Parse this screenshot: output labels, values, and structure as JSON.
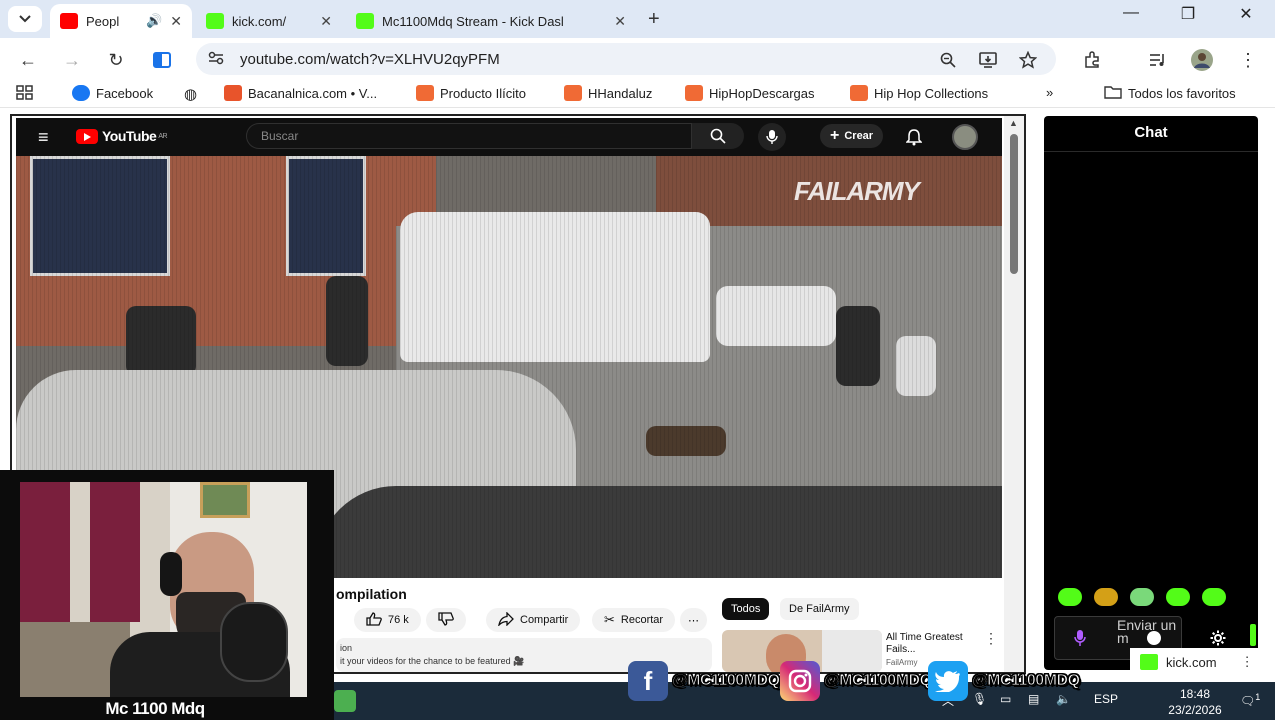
{
  "browser": {
    "tabs": [
      {
        "title": "Peopl",
        "favicon_color": "#ff0000",
        "has_audio": true
      },
      {
        "title": "kick.com/",
        "favicon_color": "#53fc18"
      },
      {
        "title": "Mc1100Mdq Stream - Kick Dasl",
        "favicon_color": "#53fc18"
      }
    ],
    "url": "youtube.com/watch?v=XLHVU2qyPFM",
    "bookmarks": [
      {
        "label": "Facebook",
        "color": "#1877f2"
      },
      {
        "label": "Bacanalnica.com • V...",
        "color": "#e8542b"
      },
      {
        "label": "Producto Ilícito",
        "color": "#f06a35"
      },
      {
        "label": "HHandaluz",
        "color": "#f06a35"
      },
      {
        "label": "HipHopDescargas",
        "color": "#f06a35"
      },
      {
        "label": "Hip Hop Collections",
        "color": "#f06a35"
      }
    ],
    "all_bookmarks_label": "Todos los favoritos"
  },
  "youtube": {
    "logo_text": "YouTube",
    "country_code": "AR",
    "search_placeholder": "Buscar",
    "create_label": "Crear",
    "watermark": "FAILARMY",
    "video_title": "ompilation",
    "likes": "76 k",
    "share_label": "Compartir",
    "clip_label": "Recortar",
    "description_line1": "ion",
    "description_line2": "it your videos for the chance to be featured 🎥",
    "chips": [
      {
        "label": "Todos",
        "active": true
      },
      {
        "label": "De FailArmy",
        "active": false
      }
    ],
    "recommendation": {
      "title": "All Time Greatest Fails...",
      "channel": "FailArmy"
    }
  },
  "chat": {
    "title": "Chat",
    "input_placeholder": "Enviar un m",
    "emote_colors": [
      "#53fc18",
      "#d4a017",
      "#7ad97a",
      "#53fc18",
      "#53fc18"
    ]
  },
  "kick_bar_label": "kick.com",
  "webcam": {
    "name": "Mc 1100 Mdq"
  },
  "social": [
    {
      "network": "facebook",
      "handle": "@MC1100MDQ",
      "color": "#3b5998"
    },
    {
      "network": "instagram",
      "handle": "@MC1100MDQ",
      "color": "#d62976"
    },
    {
      "network": "twitter",
      "handle": "@MC1100MDQ",
      "color": "#1da1f2"
    }
  ],
  "taskbar": {
    "language": "ESP",
    "time": "18:48",
    "date": "23/2/2026",
    "notification_count": "1"
  }
}
